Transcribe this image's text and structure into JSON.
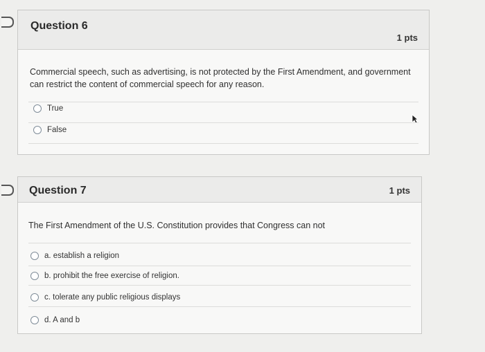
{
  "questions": [
    {
      "title": "Question 6",
      "points": "1 pts",
      "text": "Commercial speech, such as advertising, is not protected by the First Amendment, and government can restrict the content of commercial speech for any reason.",
      "options": [
        "True",
        "False"
      ]
    },
    {
      "title": "Question 7",
      "points": "1 pts",
      "text": "The First Amendment of the U.S. Constitution provides that Congress can not",
      "options": [
        "a. establish a religion",
        "b. prohibit the free exercise of religion.",
        "c. tolerate any public religious displays",
        "d. A and b"
      ]
    }
  ]
}
